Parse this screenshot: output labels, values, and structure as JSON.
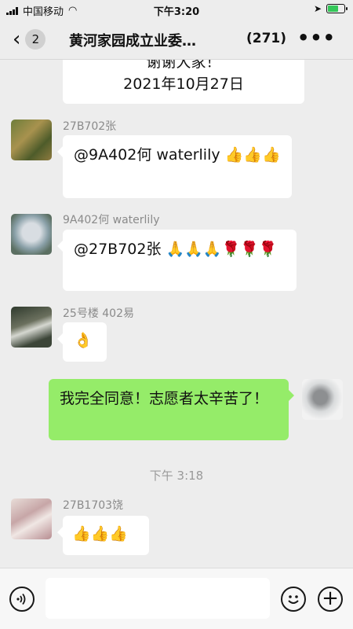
{
  "status_bar": {
    "carrier": "中国移动",
    "time": "下午3:20"
  },
  "nav": {
    "back_icon": "chevron-left-icon",
    "unread_count": "2",
    "title": "黄河家园成立业委…",
    "member_count": "(271)",
    "more_icon": "more-dots-icon"
  },
  "messages": {
    "top_bubble": {
      "line1": "谢谢大家！",
      "line2": "2021年10月27日"
    },
    "m1": {
      "sender": "27B702张",
      "text": "@9A402何 waterlily",
      "emojis": "👍👍👍"
    },
    "m2": {
      "sender": "9A402何 waterlily",
      "text": "@27B702张",
      "emojis": "🙏🙏🙏🌹🌹🌹"
    },
    "m3": {
      "sender": "25号楼 402易",
      "emojis": "👌"
    },
    "m4": {
      "text": "我完全同意！志愿者太辛苦了！"
    },
    "timestamp": "下午 3:18",
    "m5": {
      "sender": "27B1703饶",
      "emojis": "👍👍👍"
    }
  },
  "input_bar": {
    "voice_icon": "voice-icon",
    "emoji_icon": "emoji-face-icon",
    "plus_icon": "plus-icon",
    "placeholder": ""
  },
  "colors": {
    "background": "#ededed",
    "incoming_bubble": "#ffffff",
    "outgoing_bubble": "#95ec69",
    "meta_text": "#8a8a8a"
  }
}
